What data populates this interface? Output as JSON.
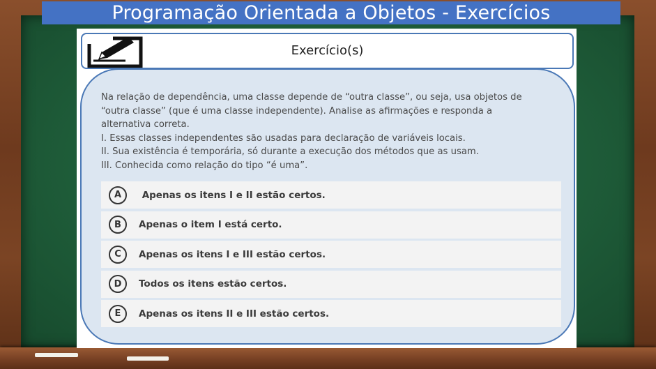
{
  "title": "Programação Orientada a Objetos - Exercícios",
  "header": {
    "icon": "pencil-edit-icon",
    "label": "Exercício(s)"
  },
  "question": {
    "lines": [
      "Na relação de dependência, uma classe depende de “outra classe”, ou seja, usa objetos de",
      "“outra classe” (que é uma classe independente). Analise as afirmações e responda a",
      "alternativa correta.",
      "I. Essas classes independentes são usadas para declaração de variáveis locais.",
      "II. Sua existência é temporária, só durante a execução dos métodos que as usam.",
      "III. Conhecida como relação do tipo “é uma”."
    ]
  },
  "options": [
    {
      "letter": "A",
      "text": " Apenas os itens I e II estão certos."
    },
    {
      "letter": "B",
      "text": "Apenas o item I está certo."
    },
    {
      "letter": "C",
      "text": "Apenas os itens I e III estão certos."
    },
    {
      "letter": "D",
      "text": "Todos os itens estão certos."
    },
    {
      "letter": "E",
      "text": "Apenas os itens II e III estão certos."
    }
  ],
  "colors": {
    "title_bar": "#4472c4",
    "border": "#4a78b6",
    "question_bg": "#dce6f1",
    "board": "#1f5e3a",
    "frame": "#6e3a1e"
  }
}
